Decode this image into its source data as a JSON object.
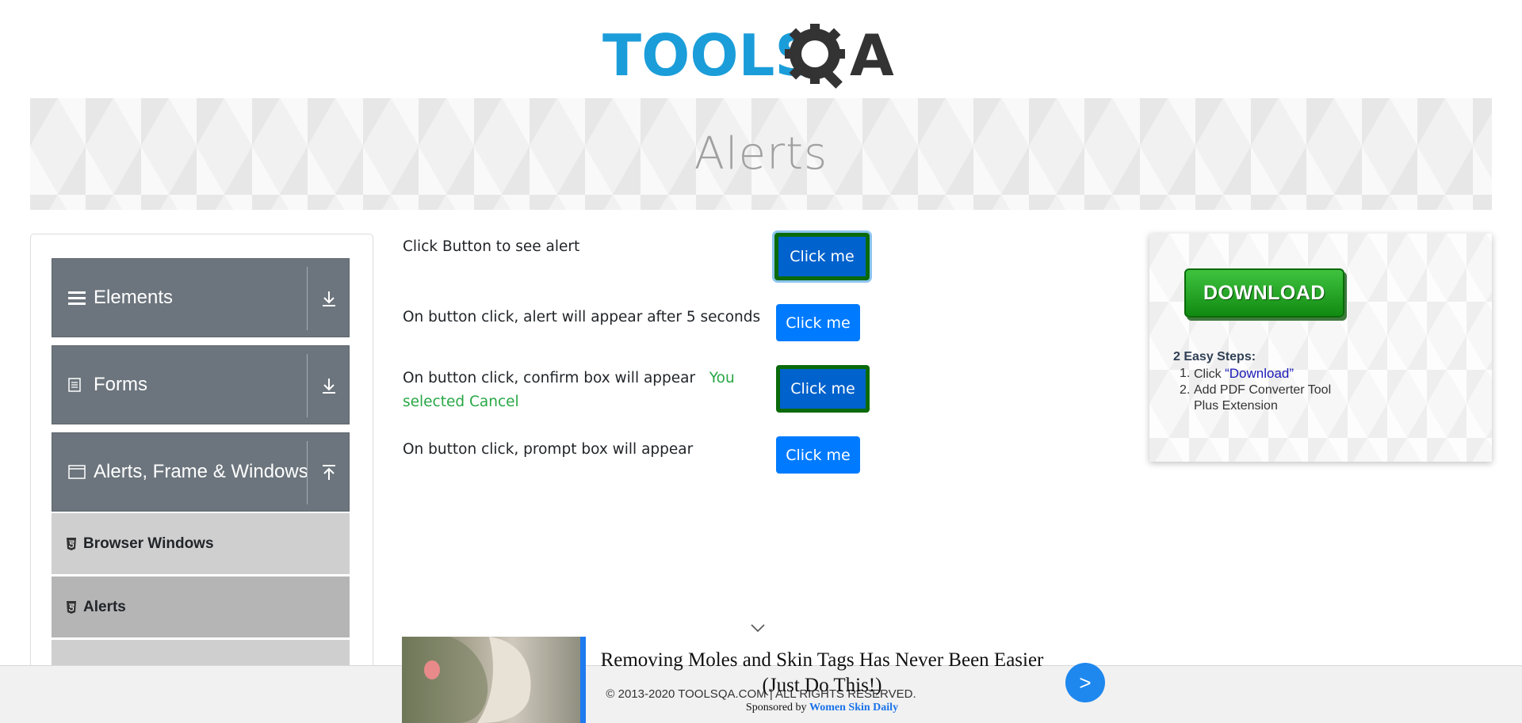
{
  "header": {
    "logo_text_left": "TOOLS",
    "logo_text_right": "A",
    "logo_icon": "gear-magnifier-icon",
    "brand_color": "#1a9dd9",
    "dark_color": "#333333"
  },
  "banner": {
    "title": "Alerts"
  },
  "sidebar": {
    "groups": [
      {
        "label": "Elements",
        "icon": "menu-icon",
        "toggle_icon": "download-arrow-icon"
      },
      {
        "label": "Forms",
        "icon": "form-icon",
        "toggle_icon": "download-arrow-icon"
      },
      {
        "label": "Alerts, Frame & Windows",
        "icon": "window-icon",
        "toggle_icon": "upload-arrow-icon"
      }
    ],
    "items": [
      {
        "label": "Browser Windows",
        "icon": "html5-icon",
        "active": false
      },
      {
        "label": "Alerts",
        "icon": "html5-icon",
        "active": true
      }
    ]
  },
  "main": {
    "rows": [
      {
        "text": "Click Button to see alert",
        "button": "Click me"
      },
      {
        "text": "On button click, alert will appear after 5 seconds",
        "button": "Click me"
      },
      {
        "text": "On button click, confirm box will appear",
        "result": "You selected Cancel",
        "button": "Click me"
      },
      {
        "text": "On button click, prompt box will appear",
        "button": "Click me"
      }
    ]
  },
  "right_ad": {
    "button": "DOWNLOAD",
    "steps_title": "2 Easy Steps:",
    "step1_prefix": "Click ",
    "step1_link": "“Download”",
    "step2_line1": "Add PDF Converter Tool",
    "step2_line2": "Plus Extension"
  },
  "bottom_ad": {
    "headline": "Removing Moles and Skin Tags Has Never Been Easier (Just Do This!)",
    "sponsor_prefix": "Sponsored by ",
    "sponsor_name": "Women Skin Daily",
    "next_label": ">"
  },
  "footer": {
    "text": "© 2013-2020 TOOLSQA.COM | ALL RIGHTS RESERVED."
  }
}
